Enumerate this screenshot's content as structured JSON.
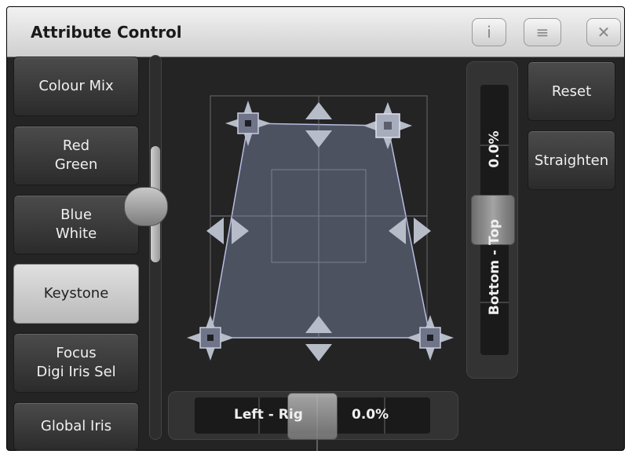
{
  "window": {
    "title": "Attribute Control",
    "buttons": [
      {
        "name": "info",
        "label": "i"
      },
      {
        "name": "menu",
        "label": "≡"
      },
      {
        "name": "close",
        "label": "✕"
      }
    ]
  },
  "attributes": [
    {
      "line1": "Colour Mix",
      "line2": ""
    },
    {
      "line1": "Red",
      "line2": "Green"
    },
    {
      "line1": "Blue",
      "line2": "White"
    },
    {
      "line1": "Keystone",
      "line2": ""
    },
    {
      "line1": "Focus",
      "line2": "Digi Iris Sel"
    },
    {
      "line1": "Global Iris",
      "line2": ""
    }
  ],
  "active_attribute": "Keystone",
  "side_buttons": {
    "reset": "Reset",
    "straighten": "Straighten"
  },
  "vertical_slider": {
    "label": "Bottom - Top",
    "value": "0.0%"
  },
  "horizontal_slider": {
    "label": "Left - Rig",
    "value": "0.0%"
  },
  "colors": {
    "shape_fill": "#4d5261",
    "shape_stroke": "#b9bde0",
    "background": "#242424"
  }
}
